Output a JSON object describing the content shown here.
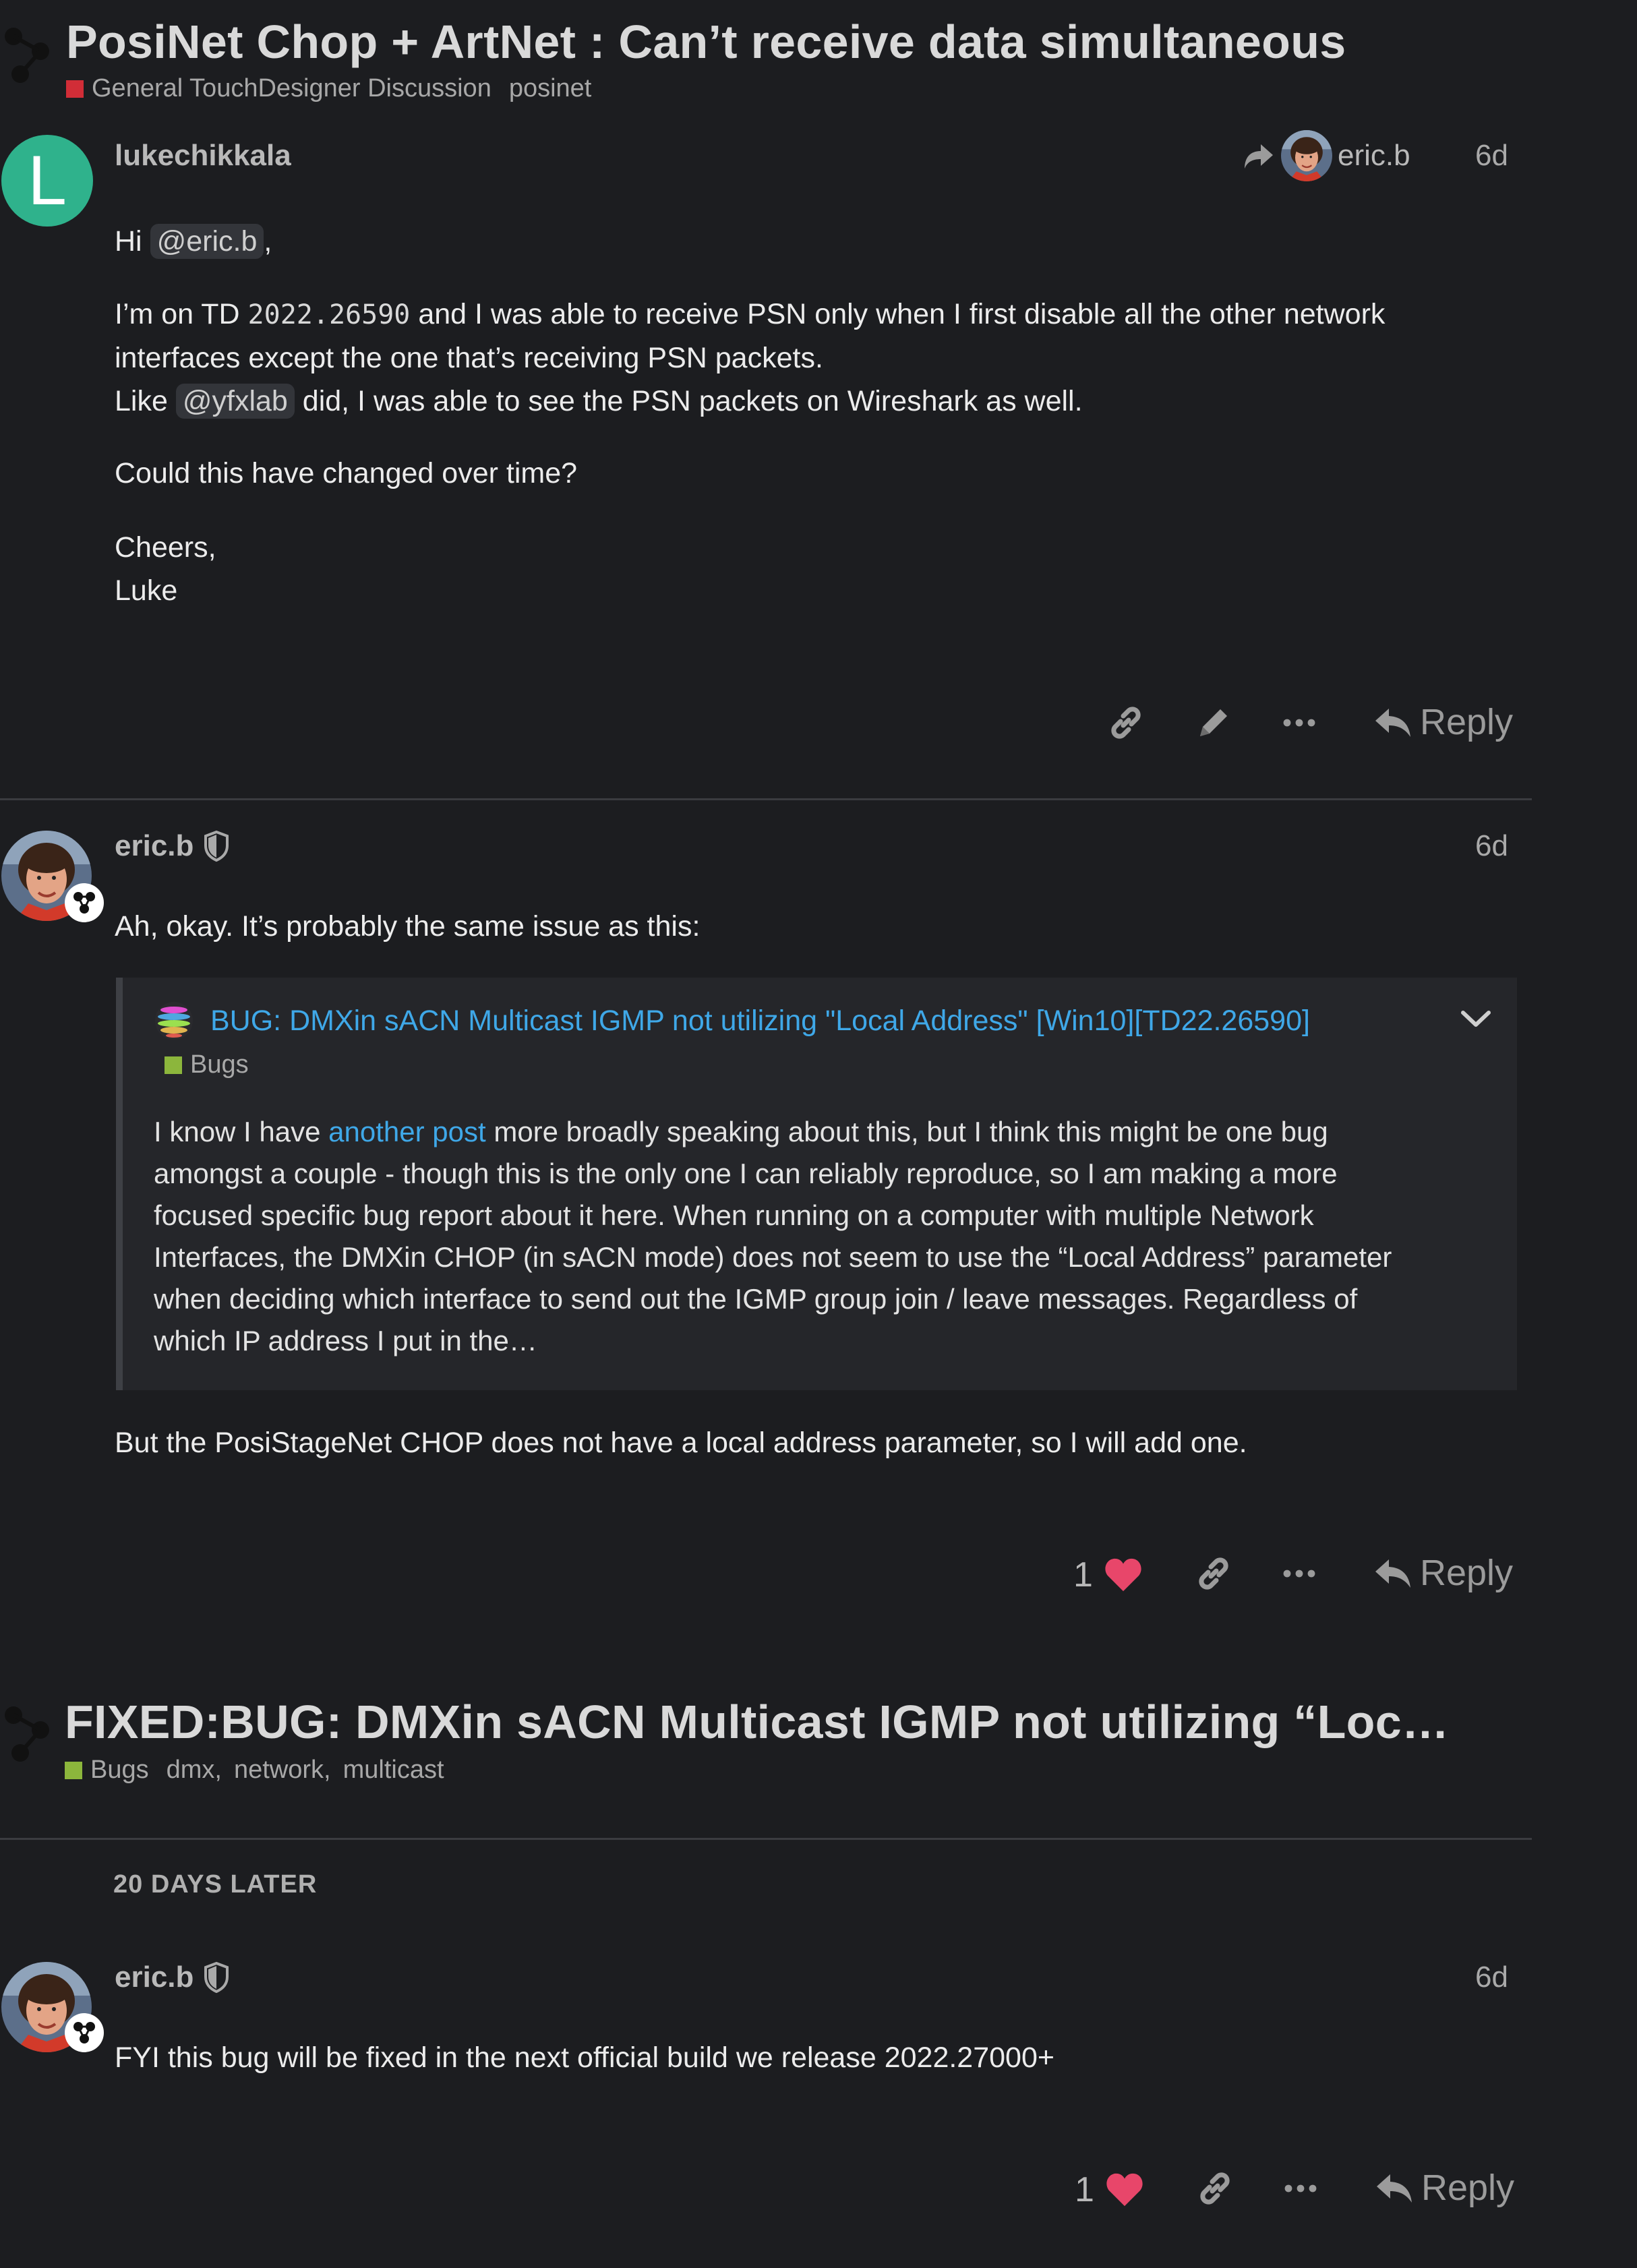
{
  "topic": {
    "title": "PosiNet Chop + ArtNet : Can’t receive data simultaneous",
    "category": "General TouchDesigner Discussion",
    "category_color": "#d12d37",
    "tag": "posinet"
  },
  "post1": {
    "username": "lukechikkala",
    "avatar_letter": "L",
    "avatar_color": "#2fb28c",
    "reply_to": "eric.b",
    "date": "6d",
    "greeting_hi": "Hi",
    "mention1": "@eric.b",
    "greeting_comma": ",",
    "p2_a": "I’m on TD",
    "p2_code": "2022.26590",
    "p2_b": "and I was able to receive PSN only when I first disable all the other network",
    "p2_c": "interfaces except the one that’s receiving PSN packets.",
    "p2_like": "Like",
    "mention2": "@yfxlab",
    "p2_d": "did, I was able to see the PSN packets on Wireshark as well.",
    "p3": "Could this have changed over time?",
    "p4": "Cheers,",
    "p5": "Luke",
    "reply_label": "Reply"
  },
  "post2": {
    "username": "eric.b",
    "date": "6d",
    "intro": "Ah, okay. It’s probably the same issue as this:",
    "quote_title": "BUG: DMXin sACN Multicast IGMP not utilizing \"Local Address\" [Win10][TD22.26590]",
    "quote_category": "Bugs",
    "quote_category_color": "#8cb63c",
    "quote_l1_a": "I know I have",
    "quote_l1_link": "another post",
    "quote_l1_b": "more broadly speaking about this, but I think this might be one bug",
    "quote_l2": "amongst a couple - though this is the only one I can reliably reproduce, so I am making a more",
    "quote_l3": "focused specific bug report about it here. When running on a computer with multiple Network",
    "quote_l4": "Interfaces, the DMXin CHOP (in sACN mode) does not seem to use the “Local Address” parameter",
    "quote_l5": "when deciding which interface to send out the IGMP group join / leave messages. Regardless of",
    "quote_l6": "which IP address I put in the…",
    "outro": "But the PosiStageNet CHOP does not have a local address parameter, so I will add one.",
    "likes": "1",
    "reply_label": "Reply"
  },
  "linked_topic": {
    "title": "FIXED:BUG: DMXin sACN Multicast IGMP not utilizing “Loc…",
    "category": "Bugs",
    "category_color": "#8cb63c",
    "tags": [
      "dmx",
      "network",
      "multicast"
    ],
    "sep": ","
  },
  "time_gap": "20 DAYS LATER",
  "post3": {
    "username": "eric.b",
    "date": "6d",
    "text": "FYI this bug will be fixed in the next official build we release 2022.27000+",
    "likes": "1",
    "reply_label": "Reply"
  }
}
